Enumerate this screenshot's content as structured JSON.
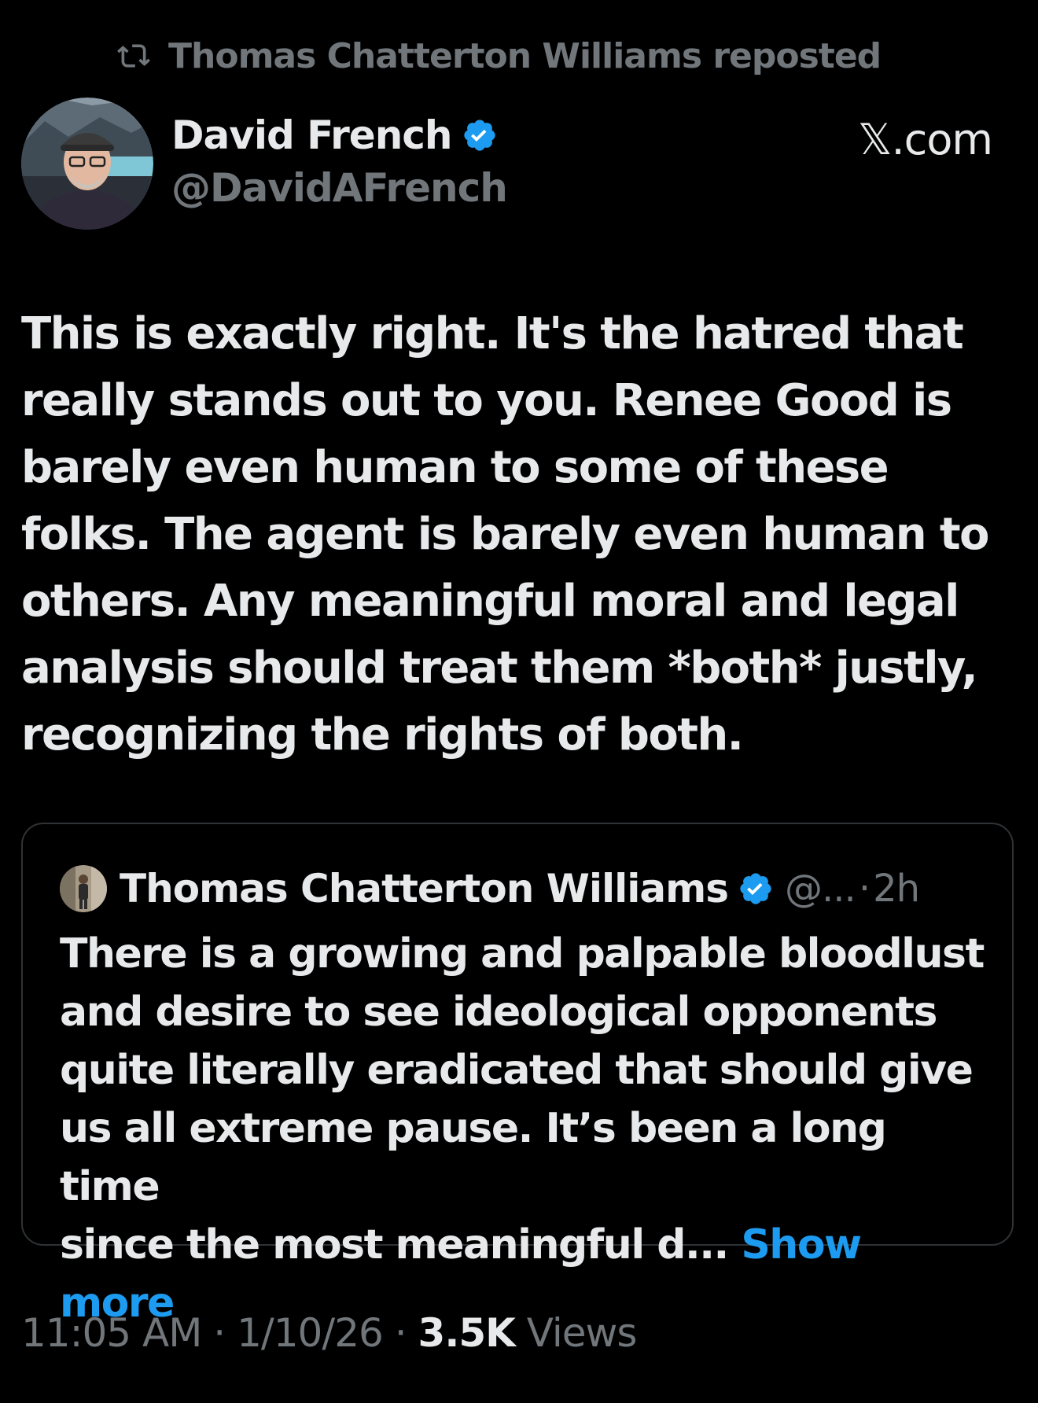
{
  "repost": {
    "icon": "repost-icon",
    "text": "Thomas Chatterton Williams reposted"
  },
  "author": {
    "name": "David French",
    "handle": "@DavidAFrench",
    "verified": true
  },
  "site": "𝕏.com",
  "post": {
    "lines": [
      "This is exactly right. It's the hatred that",
      "really stands out to you. Renee Good is",
      "barely even human to some of these",
      "folks. The agent is barely even human to",
      "others. Any meaningful moral and legal",
      "analysis should treat them *both* justly,",
      "recognizing the rights of both."
    ]
  },
  "quoted": {
    "name": "Thomas Chatterton Williams",
    "handle": "@...",
    "separator": "·",
    "time": "2h",
    "lines": [
      "There is a growing and palpable bloodlust",
      "and desire to see ideological opponents",
      "quite literally eradicated that should give",
      "us all extreme pause. It’s been a long time",
      "since the most meaningful d..."
    ],
    "show_more": "Show more"
  },
  "meta": {
    "time": "11:05 AM",
    "sep1": "·",
    "date": "1/10/26",
    "sep2": "·",
    "views_count": "3.5K",
    "views_label": "Views"
  },
  "colors": {
    "background": "#000000",
    "text": "#e7e9ea",
    "muted": "#71767b",
    "accent": "#1d9bf0",
    "border": "#2f3336"
  }
}
